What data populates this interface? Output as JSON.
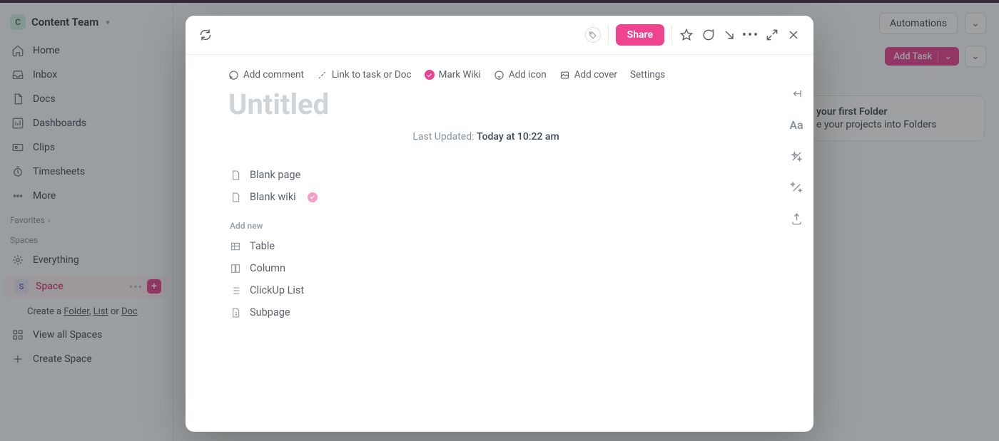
{
  "workspace": {
    "initial": "C",
    "name": "Content Team"
  },
  "sidebar_nav": [
    {
      "key": "home",
      "label": "Home"
    },
    {
      "key": "inbox",
      "label": "Inbox"
    },
    {
      "key": "docs",
      "label": "Docs"
    },
    {
      "key": "dashboards",
      "label": "Dashboards"
    },
    {
      "key": "clips",
      "label": "Clips"
    },
    {
      "key": "timesheets",
      "label": "Timesheets"
    },
    {
      "key": "more",
      "label": "More"
    }
  ],
  "sections": {
    "favorites": "Favorites",
    "spaces": "Spaces"
  },
  "space_tree": {
    "everything": "Everything",
    "space_initial": "S",
    "space_name": "Space",
    "create_prefix": "Create a ",
    "folder": "Folder",
    "list": "List",
    "or": " or ",
    "doc": "Doc",
    "view_all": "View all Spaces",
    "create_space": "Create Space"
  },
  "header": {
    "automations": "Automations",
    "add_task": "Add Task"
  },
  "hint_card": {
    "title": "your first Folder",
    "sub": "e your projects into Folders"
  },
  "modal": {
    "share": "Share",
    "actions": {
      "add_comment": "Add comment",
      "link_task": "Link to task or Doc",
      "mark_wiki": "Mark Wiki",
      "add_icon": "Add icon",
      "add_cover": "Add cover",
      "settings": "Settings"
    },
    "title_placeholder": "Untitled",
    "last_updated_label": "Last Updated:",
    "last_updated_value": "Today at 10:22 am",
    "templates": {
      "blank_page": "Blank page",
      "blank_wiki": "Blank wiki"
    },
    "add_new_label": "Add new",
    "add_new": {
      "table": "Table",
      "column": "Column",
      "clickup_list": "ClickUp List",
      "subpage": "Subpage"
    }
  }
}
